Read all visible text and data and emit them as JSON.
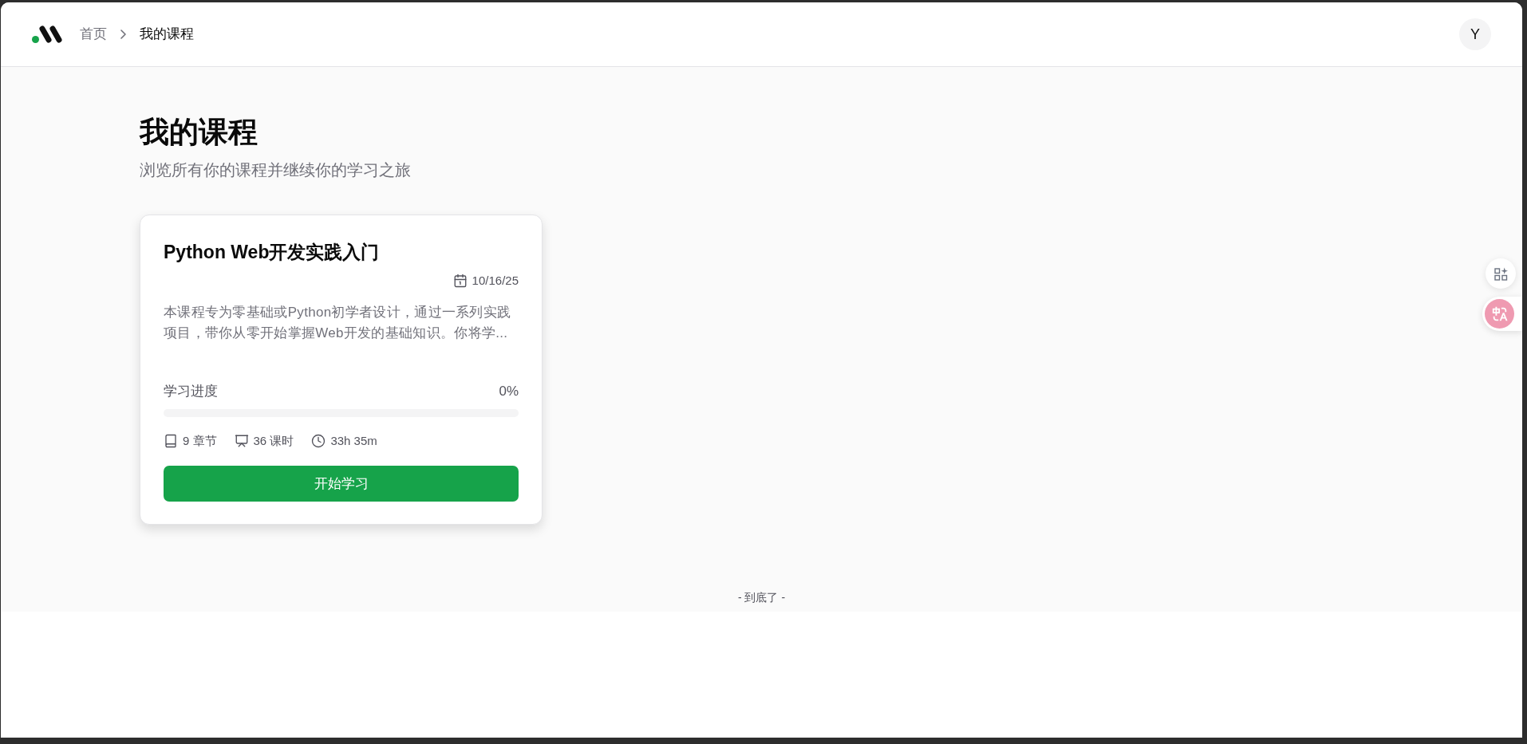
{
  "header": {
    "breadcrumbs": [
      {
        "label": "首页",
        "current": false
      },
      {
        "label": "我的课程",
        "current": true
      }
    ],
    "avatar": "Y"
  },
  "page": {
    "title": "我的课程",
    "subtitle": "浏览所有你的课程并继续你的学习之旅"
  },
  "courses": [
    {
      "title": "Python Web开发实践入门",
      "date": "10/16/25",
      "description": "本课程专为零基础或Python初学者设计，通过一系列实践项目，带你从零开始掌握Web开发的基础知识。你将学...",
      "progress_label": "学习进度",
      "progress_text": "0%",
      "stats": [
        {
          "kind": "chapters",
          "text": "9 章节"
        },
        {
          "kind": "lessons",
          "text": "36 课时"
        },
        {
          "kind": "duration",
          "text": "33h 35m"
        }
      ],
      "button": "开始学习"
    }
  ],
  "end_text": "- 到底了 -"
}
